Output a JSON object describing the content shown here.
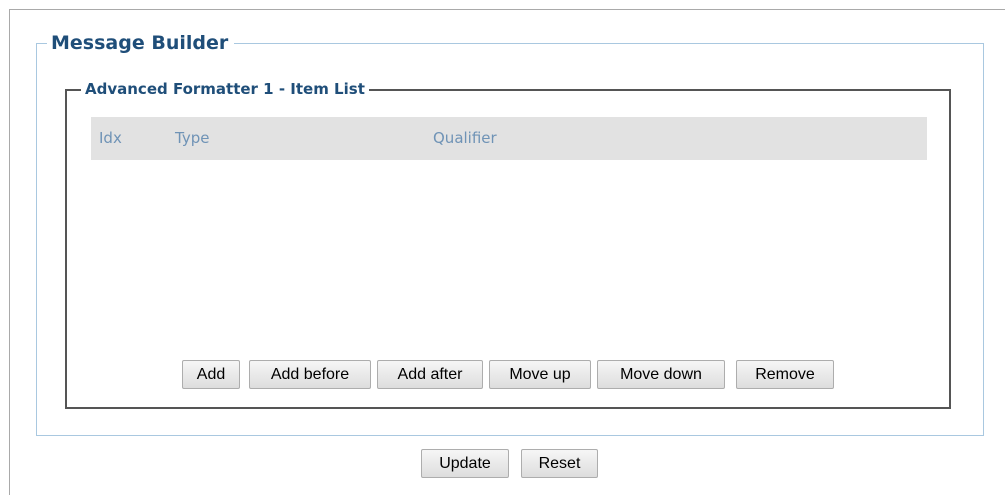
{
  "panel": {
    "title": "Message Builder"
  },
  "item_list": {
    "title": "Advanced Formatter 1 - Item List",
    "columns": [
      "Idx",
      "Type",
      "Qualifier"
    ],
    "rows": []
  },
  "list_buttons": {
    "add": "Add",
    "add_before": "Add before",
    "add_after": "Add after",
    "move_up": "Move up",
    "move_down": "Move down",
    "remove": "Remove"
  },
  "form_buttons": {
    "update": "Update",
    "reset": "Reset"
  },
  "colors": {
    "legend_text": "#1f4e79",
    "header_text": "#6f93b6",
    "header_bg": "#e2e2e2",
    "outer_border": "#a9c8e0",
    "inner_border": "#555555"
  }
}
